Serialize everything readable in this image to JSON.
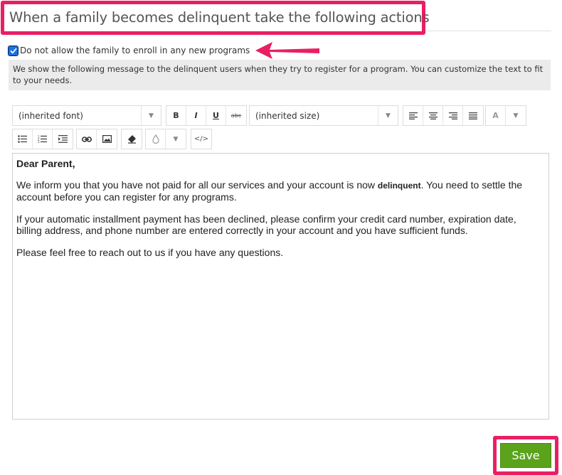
{
  "heading": {
    "title": "When a family becomes delinquent take the following actions"
  },
  "enroll_option": {
    "checked": true,
    "label": "Do not allow the family to enroll in any new programs"
  },
  "info": {
    "text": "We show the following message to the delinquent users when they try to register for a program. You can customize the text to fit to your needs."
  },
  "toolbar": {
    "font_select": "(inherited font)",
    "size_select": "(inherited size)",
    "bold": "B",
    "italic": "I",
    "underline": "U",
    "strikethrough": "abc",
    "font_color": "A",
    "source": "</>"
  },
  "editor": {
    "greeting": "Dear Parent,",
    "p1_before": "We inform you that you have not paid for all our services and your account is now ",
    "p1_bold": "delinquent",
    "p1_after": ". You need to settle the account before you can register for any programs.",
    "p2": "If your automatic installment payment has been declined, please confirm your credit card number, expiration date, billing address, and phone number are entered correctly in your account and you have sufficient funds.",
    "p3": "Please feel free to reach out to us if you have any questions."
  },
  "actions": {
    "save_label": "Save"
  },
  "colors": {
    "highlight": "#ea1e63",
    "save_green": "#5aa31a",
    "checkbox_blue": "#1a73e8",
    "info_bg": "#ebebeb"
  }
}
